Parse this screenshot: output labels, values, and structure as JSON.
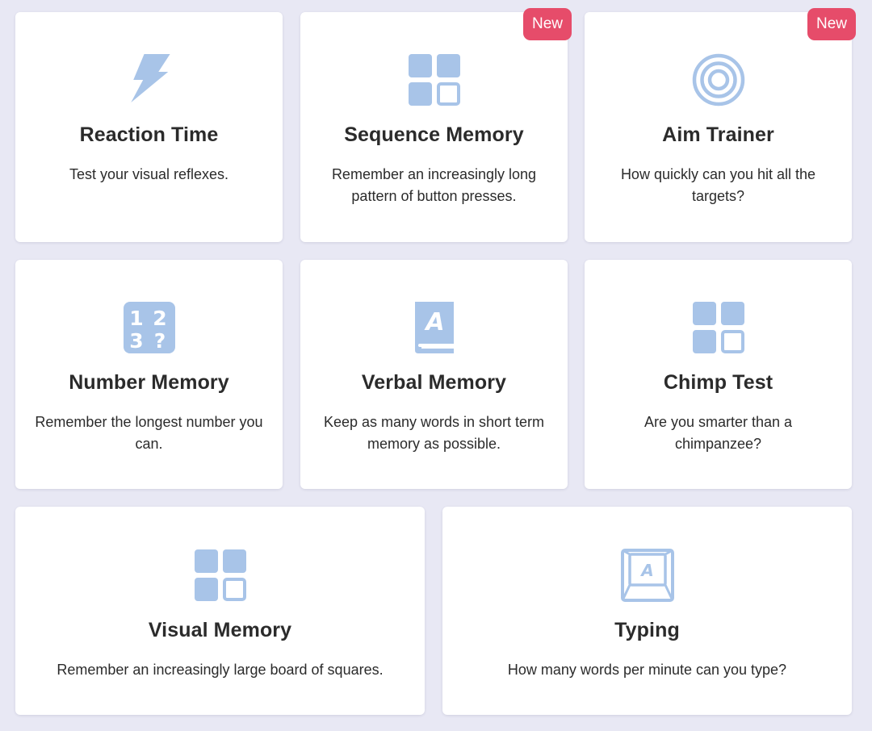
{
  "theme": {
    "background": "#e8e8f4",
    "card_background": "#ffffff",
    "icon_color": "#a8c4e8",
    "badge_color": "#e64c6a",
    "text_color": "#2b2b2b"
  },
  "cards": [
    {
      "title": "Reaction Time",
      "description": "Test your visual reflexes.",
      "icon": "lightning-bolt-icon",
      "badge": ""
    },
    {
      "title": "Sequence Memory",
      "description": "Remember an increasingly long pattern of button presses.",
      "icon": "grid-squares-icon",
      "badge": "New"
    },
    {
      "title": "Aim Trainer",
      "description": "How quickly can you hit all the targets?",
      "icon": "target-icon",
      "badge": "New"
    },
    {
      "title": "Number Memory",
      "description": "Remember the longest number you can.",
      "icon": "numbers-icon",
      "icon_text": [
        "1",
        "2",
        "3",
        "?"
      ],
      "badge": ""
    },
    {
      "title": "Verbal Memory",
      "description": "Keep as many words in short term memory as possible.",
      "icon": "book-icon",
      "icon_text": [
        "A"
      ],
      "badge": ""
    },
    {
      "title": "Chimp Test",
      "description": "Are you smarter than a chimpanzee?",
      "icon": "grid-squares-icon",
      "badge": ""
    },
    {
      "title": "Visual Memory",
      "description": "Remember an increasingly large board of squares.",
      "icon": "grid-squares-icon",
      "badge": ""
    },
    {
      "title": "Typing",
      "description": "How many words per minute can you type?",
      "icon": "keyboard-key-icon",
      "icon_text": [
        "A"
      ],
      "badge": ""
    }
  ]
}
